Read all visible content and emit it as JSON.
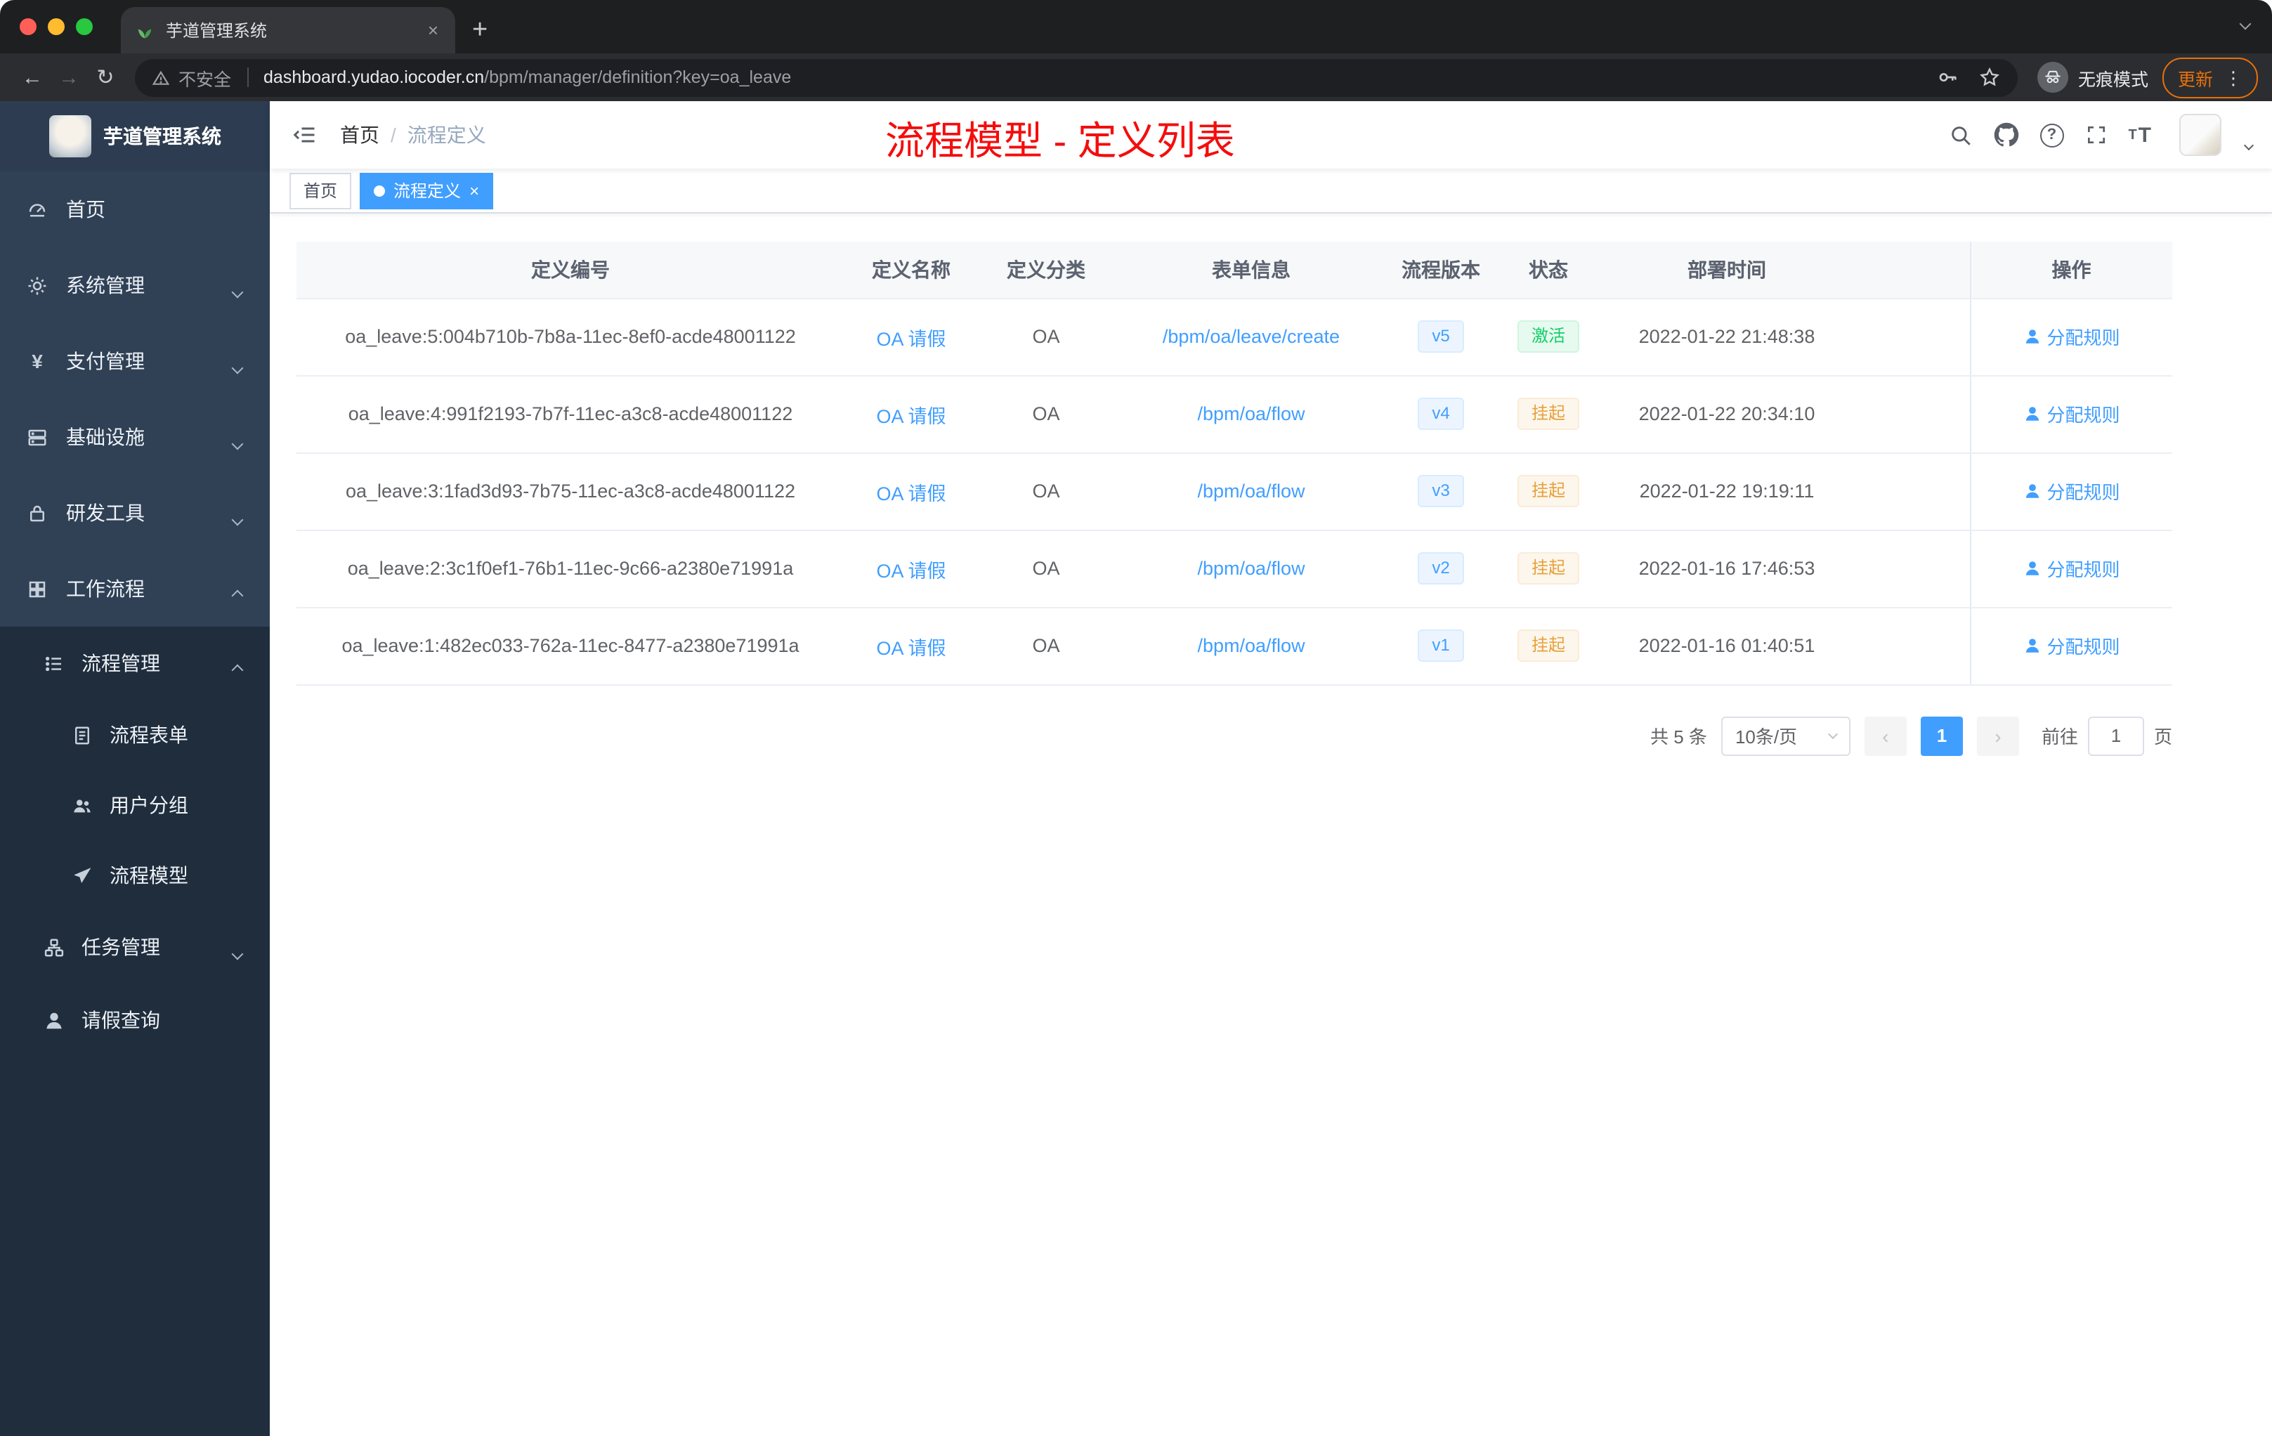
{
  "browser": {
    "tab": {
      "title": "芋道管理系统"
    },
    "security_label": "不安全",
    "url_domain": "dashboard.yudao.iocoder.cn",
    "url_path": "/bpm/manager/definition?key=oa_leave",
    "incognito_label": "无痕模式",
    "update_label": "更新"
  },
  "sidebar": {
    "logo_title": "芋道管理系统",
    "items": [
      {
        "label": "首页"
      },
      {
        "label": "系统管理"
      },
      {
        "label": "支付管理"
      },
      {
        "label": "基础设施"
      },
      {
        "label": "研发工具"
      },
      {
        "label": "工作流程"
      }
    ],
    "submenu": {
      "process_mgmt_label": "流程管理",
      "children": [
        {
          "label": "流程表单"
        },
        {
          "label": "用户分组"
        },
        {
          "label": "流程模型"
        }
      ],
      "task_mgmt_label": "任务管理",
      "leave_query_label": "请假查询"
    }
  },
  "navbar": {
    "breadcrumb": {
      "home": "首页",
      "sep": "/",
      "current": "流程定义"
    },
    "annotation": "流程模型 - 定义列表"
  },
  "tags": {
    "home": "首页",
    "active": "流程定义"
  },
  "table": {
    "columns": {
      "id": "定义编号",
      "name": "定义名称",
      "category": "定义分类",
      "form": "表单信息",
      "version": "流程版本",
      "status": "状态",
      "time": "部署时间",
      "action": "操作"
    },
    "rows": [
      {
        "id": "oa_leave:5:004b710b-7b8a-11ec-8ef0-acde48001122",
        "name": "OA 请假",
        "category": "OA",
        "form": "/bpm/oa/leave/create",
        "version": "v5",
        "status": "激活",
        "time": "2022-01-22 21:48:38",
        "action": "分配规则"
      },
      {
        "id": "oa_leave:4:991f2193-7b7f-11ec-a3c8-acde48001122",
        "name": "OA 请假",
        "category": "OA",
        "form": "/bpm/oa/flow",
        "version": "v4",
        "status": "挂起",
        "time": "2022-01-22 20:34:10",
        "action": "分配规则"
      },
      {
        "id": "oa_leave:3:1fad3d93-7b75-11ec-a3c8-acde48001122",
        "name": "OA 请假",
        "category": "OA",
        "form": "/bpm/oa/flow",
        "version": "v3",
        "status": "挂起",
        "time": "2022-01-22 19:19:11",
        "action": "分配规则"
      },
      {
        "id": "oa_leave:2:3c1f0ef1-76b1-11ec-9c66-a2380e71991a",
        "name": "OA 请假",
        "category": "OA",
        "form": "/bpm/oa/flow",
        "version": "v2",
        "status": "挂起",
        "time": "2022-01-16 17:46:53",
        "action": "分配规则"
      },
      {
        "id": "oa_leave:1:482ec033-762a-11ec-8477-a2380e71991a",
        "name": "OA 请假",
        "category": "OA",
        "form": "/bpm/oa/flow",
        "version": "v1",
        "status": "挂起",
        "time": "2022-01-16 01:40:51",
        "action": "分配规则"
      }
    ]
  },
  "pagination": {
    "total": "共 5 条",
    "page_size": "10条/页",
    "page": "1",
    "goto_label": "前往",
    "goto_value": "1",
    "goto_unit": "页"
  },
  "colors": {
    "accent": "#409eff",
    "annotation_red": "#f40d0d",
    "status_active": "#13ce66",
    "status_suspended": "#e6a23c"
  }
}
